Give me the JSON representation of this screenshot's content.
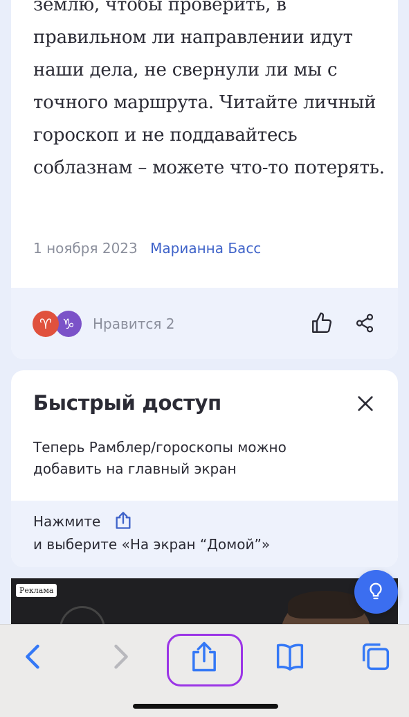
{
  "article": {
    "text": "землю, чтобы проверить, в правильном ли направлении идут наши дела, не свернули ли мы с точного маршрута. Читайте личный гороскоп и не поддавайтесь соблазнам – можете что-то потерять.",
    "date": "1 ноября 2023",
    "author": "Марианна Басс",
    "reactions": {
      "sign1": "♈",
      "sign2": "♑",
      "likes_label": "Нравится 2"
    }
  },
  "quick_access": {
    "title": "Быстрый доступ",
    "description": "Теперь Рамблер/гороскопы можно добавить на главный экран",
    "step1": "Нажмите",
    "step2": "и выберите «На экран “Домой”»"
  },
  "ad": {
    "label": "Реклама"
  },
  "colors": {
    "accent": "#3f63c9",
    "highlight": "#9b35e6",
    "assistant": "#3b6ef0"
  }
}
